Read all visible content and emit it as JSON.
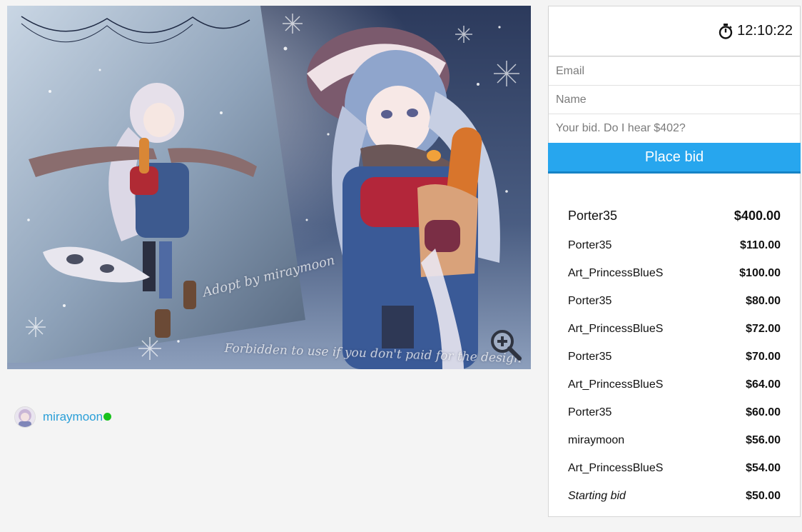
{
  "artwork": {
    "watermark_diagonal": "Adopt by miraymoon",
    "watermark_bottom": "Forbidden to use if you don't paid for the design",
    "zoom_icon": "zoom-in-icon"
  },
  "artist": {
    "name": "miraymoon",
    "status": "online",
    "status_color": "#19c21d",
    "link_color": "#2a9fd8"
  },
  "panel": {
    "timer_icon": "stopwatch-icon",
    "timer": "12:10:22",
    "email_placeholder": "Email",
    "name_placeholder": "Name",
    "bid_placeholder": "Your bid. Do I hear $402?",
    "place_bid_label": "Place bid",
    "accent_color": "#27a6ee"
  },
  "bids": {
    "top": {
      "bidder": "Porter35",
      "amount": "$400.00"
    },
    "history": [
      {
        "bidder": "Porter35",
        "amount": "$110.00"
      },
      {
        "bidder": "Art_PrincessBlueS",
        "amount": "$100.00"
      },
      {
        "bidder": "Porter35",
        "amount": "$80.00"
      },
      {
        "bidder": "Art_PrincessBlueS",
        "amount": "$72.00"
      },
      {
        "bidder": "Porter35",
        "amount": "$70.00"
      },
      {
        "bidder": "Art_PrincessBlueS",
        "amount": "$64.00"
      },
      {
        "bidder": "Porter35",
        "amount": "$60.00"
      },
      {
        "bidder": "miraymoon",
        "amount": "$56.00"
      },
      {
        "bidder": "Art_PrincessBlueS",
        "amount": "$54.00"
      }
    ],
    "starting": {
      "label": "Starting bid",
      "amount": "$50.00"
    }
  }
}
